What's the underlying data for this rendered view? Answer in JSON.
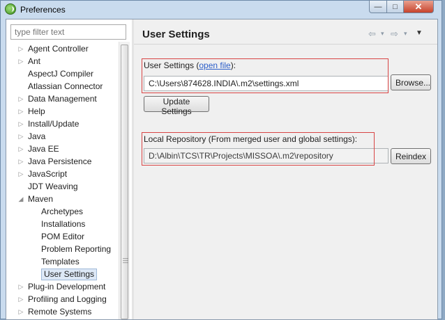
{
  "window": {
    "title": "Preferences",
    "controls": {
      "minimize": "—",
      "maximize": "□",
      "close": "✕"
    }
  },
  "sidebar": {
    "filter_placeholder": "type filter text",
    "items": [
      {
        "label": "Agent Controller",
        "expandable": true,
        "expanded": false,
        "level": 0
      },
      {
        "label": "Ant",
        "expandable": true,
        "expanded": false,
        "level": 0
      },
      {
        "label": "AspectJ Compiler",
        "expandable": false,
        "level": 0
      },
      {
        "label": "Atlassian Connector",
        "expandable": false,
        "level": 0
      },
      {
        "label": "Data Management",
        "expandable": true,
        "expanded": false,
        "level": 0
      },
      {
        "label": "Help",
        "expandable": true,
        "expanded": false,
        "level": 0
      },
      {
        "label": "Install/Update",
        "expandable": true,
        "expanded": false,
        "level": 0
      },
      {
        "label": "Java",
        "expandable": true,
        "expanded": false,
        "level": 0
      },
      {
        "label": "Java EE",
        "expandable": true,
        "expanded": false,
        "level": 0
      },
      {
        "label": "Java Persistence",
        "expandable": true,
        "expanded": false,
        "level": 0
      },
      {
        "label": "JavaScript",
        "expandable": true,
        "expanded": false,
        "level": 0
      },
      {
        "label": "JDT Weaving",
        "expandable": false,
        "level": 0
      },
      {
        "label": "Maven",
        "expandable": true,
        "expanded": true,
        "level": 0
      },
      {
        "label": "Archetypes",
        "expandable": false,
        "level": 1
      },
      {
        "label": "Installations",
        "expandable": false,
        "level": 1
      },
      {
        "label": "POM Editor",
        "expandable": false,
        "level": 1
      },
      {
        "label": "Problem Reporting",
        "expandable": false,
        "level": 1
      },
      {
        "label": "Templates",
        "expandable": false,
        "level": 1
      },
      {
        "label": "User Settings",
        "expandable": false,
        "level": 1,
        "selected": true
      },
      {
        "label": "Plug-in Development",
        "expandable": true,
        "expanded": false,
        "level": 0
      },
      {
        "label": "Profiling and Logging",
        "expandable": true,
        "expanded": false,
        "level": 0
      },
      {
        "label": "Remote Systems",
        "expandable": true,
        "expanded": false,
        "level": 0
      }
    ]
  },
  "main": {
    "title": "User Settings",
    "nav": {
      "back": "⇦",
      "back_menu": "▾",
      "forward": "⇨",
      "forward_menu": "▾",
      "view_menu": "▼"
    },
    "user_settings": {
      "label_prefix": "User Settings (",
      "link_text": "open file",
      "label_suffix": "):",
      "path_value": "C:\\Users\\874628.INDIA\\.m2\\settings.xml",
      "browse_label": "Browse...",
      "update_label": "Update Settings"
    },
    "local_repository": {
      "label": "Local Repository (From merged user and global settings):",
      "path_value": "D:\\Albin\\TCS\\TR\\Projects\\MISSOA\\.m2\\repository",
      "reindex_label": "Reindex"
    }
  },
  "colors": {
    "highlight_box": "#d84444",
    "selection_bg": "#dde8f6",
    "link": "#2b5ec9"
  }
}
